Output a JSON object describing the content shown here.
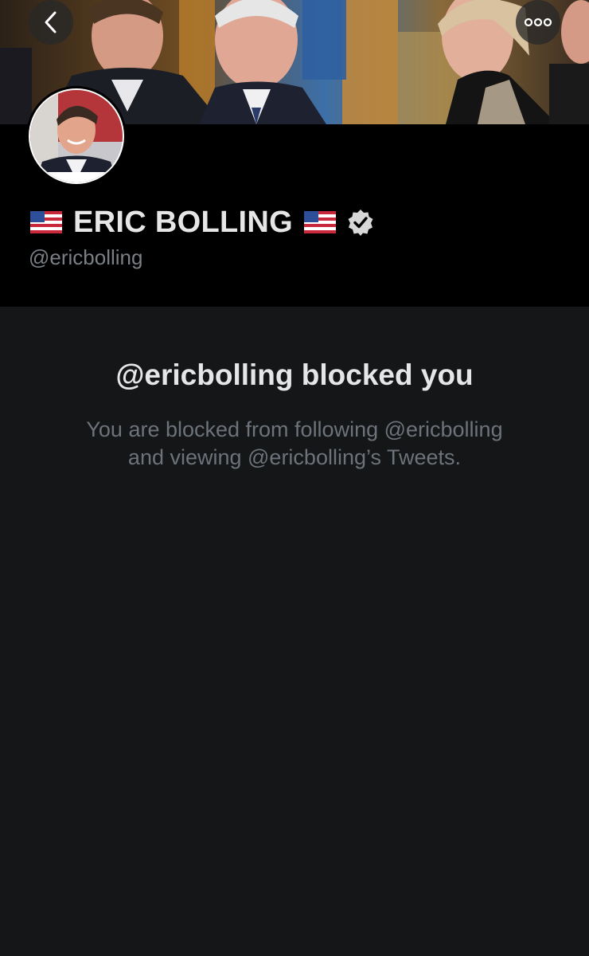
{
  "profile": {
    "display_name": "ERIC BOLLING",
    "handle": "@ericbolling",
    "verified": true,
    "flag_icon": "us-flag-emoji",
    "verified_icon": "verified-badge-icon"
  },
  "nav": {
    "back_icon": "chevron-left-icon",
    "more_icon": "more-horizontal-icon"
  },
  "blocked": {
    "title": "@ericbolling blocked you",
    "line1": "You are blocked from following @ericbolling",
    "line2": "and viewing @ericbolling’s Tweets."
  },
  "colors": {
    "background": "#151618",
    "header": "#000000",
    "title_text": "#e4e6e8",
    "muted_text": "#6d737a"
  }
}
